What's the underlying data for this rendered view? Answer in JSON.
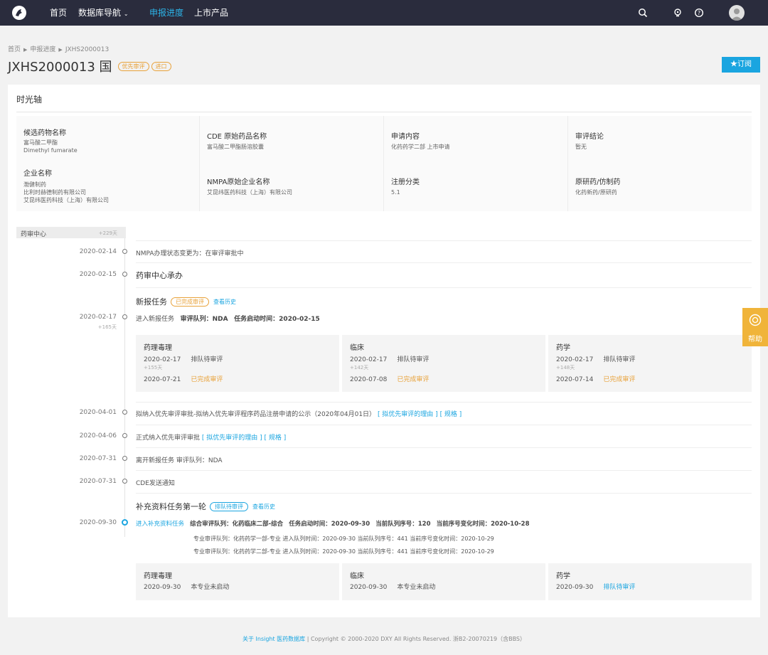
{
  "nav": {
    "home": "首页",
    "db_nav": "数据库导航",
    "progress": "申报进度",
    "listed": "上市产品"
  },
  "breadcrumb": [
    "首页",
    "申报进度",
    "JXHS2000013"
  ],
  "page": {
    "title": "JXHS2000013 国",
    "tag_priority": "优先审评",
    "tag_import": "进口",
    "subscribe": "★订阅"
  },
  "panel": {
    "title": "时光轴"
  },
  "info": {
    "candidate_label": "候选药物名称",
    "candidate_values": [
      "富马酸二甲酯",
      "Dimethyl fumarate"
    ],
    "cde_label": "CDE 原始药品名称",
    "cde_value": "富马酸二甲酯肠溶胶囊",
    "apply_label": "申请内容",
    "apply_value": "化药药学二部 上市申请",
    "conclusion_label": "审评结论",
    "conclusion_value": "暂无",
    "company_label": "企业名称",
    "company_values": [
      "渤健制药",
      "比利时赫德制药有限公司",
      "艾昆纬医药科技（上海）有限公司"
    ],
    "nmpa_label": "NMPA原始企业名称",
    "nmpa_value": "艾昆纬医药科技（上海）有限公司",
    "reg_label": "注册分类",
    "reg_value": "5.1",
    "orig_label": "原研药/仿制药",
    "orig_value": "化药新药/原研药"
  },
  "section": {
    "name": "药审中心",
    "days": "+229天"
  },
  "rows": {
    "r1_date": "2020-02-14",
    "r1_text": "NMPA办理状态变更为：在审评审批中",
    "r2_date": "2020-02-15",
    "r2_text": "药审中心承办",
    "task1_title": "新报任务",
    "task1_status": "已完成审评",
    "task1_history": "查看历史",
    "r3_date": "2020-02-17",
    "r3_days": "+165天",
    "r3_text": "进入新报任务",
    "r3_queue": "审评队列：NDA",
    "r3_start": "任务启动时间：2020-02-15",
    "r4_date": "2020-04-01",
    "r4_text": "拟纳入优先审评审批-拟纳入优先审评程序药品注册申请的公示（2020年04月01日）",
    "r4_link1": "[ 拟优先审评的理由 ]",
    "r4_link2": "[ 规格 ]",
    "r5_date": "2020-04-06",
    "r5_text": "正式纳入优先审评审批",
    "r5_link1": "[ 拟优先审评的理由 ]",
    "r5_link2": "[ 规格 ]",
    "r6_date": "2020-07-31",
    "r6_text": "离开新报任务  审评队列：NDA",
    "r7_date": "2020-07-31",
    "r7_text": "CDE发送通知",
    "task2_title": "补充资料任务第一轮",
    "task2_status": "排队待审评",
    "task2_history": "查看历史",
    "r8_date": "2020-09-30",
    "r8_link": "进入补充资料任务",
    "r8_main": "综合审评队列：化药临床二部-综合",
    "r8_start": "任务启动时间：2020-09-30",
    "r8_seq": "当前队列序号：120",
    "r8_change": "当前序号变化时间：2020-10-28",
    "r8_sub1": "专业审评队列：化药药学一部-专业   进入队列时间：2020-09-30   当前队列序号：441   当前序号变化时间：2020-10-29",
    "r8_sub2": "专业审评队列：化药药学二部-专业   进入队列时间：2020-09-30   当前队列序号：441   当前序号变化时间：2020-10-29"
  },
  "cards1": [
    {
      "title": "药理毒理",
      "d1": "2020-02-17",
      "s1": "排队待审评",
      "days": "+155天",
      "d2": "2020-07-21",
      "s2": "已完成审评"
    },
    {
      "title": "临床",
      "d1": "2020-02-17",
      "s1": "排队待审评",
      "days": "+142天",
      "d2": "2020-07-08",
      "s2": "已完成审评"
    },
    {
      "title": "药学",
      "d1": "2020-02-17",
      "s1": "排队待审评",
      "days": "+148天",
      "d2": "2020-07-14",
      "s2": "已完成审评"
    }
  ],
  "cards2": [
    {
      "title": "药理毒理",
      "d1": "2020-09-30",
      "s1": "本专业未启动"
    },
    {
      "title": "临床",
      "d1": "2020-09-30",
      "s1": "本专业未启动"
    },
    {
      "title": "药学",
      "d1": "2020-09-30",
      "s1": "排队待审评"
    }
  ],
  "help": {
    "label": "帮助"
  },
  "footer": {
    "about": "关于 Insight 医药数据库",
    "copyright": "|  Copyright © 2000-2020 DXY All Rights Reserved. 浙B2-20070219（含BBS）"
  },
  "colors": {
    "nav_bg": "#2a2c3d",
    "accent": "#1aa5e0",
    "orange": "#e8a23a"
  }
}
